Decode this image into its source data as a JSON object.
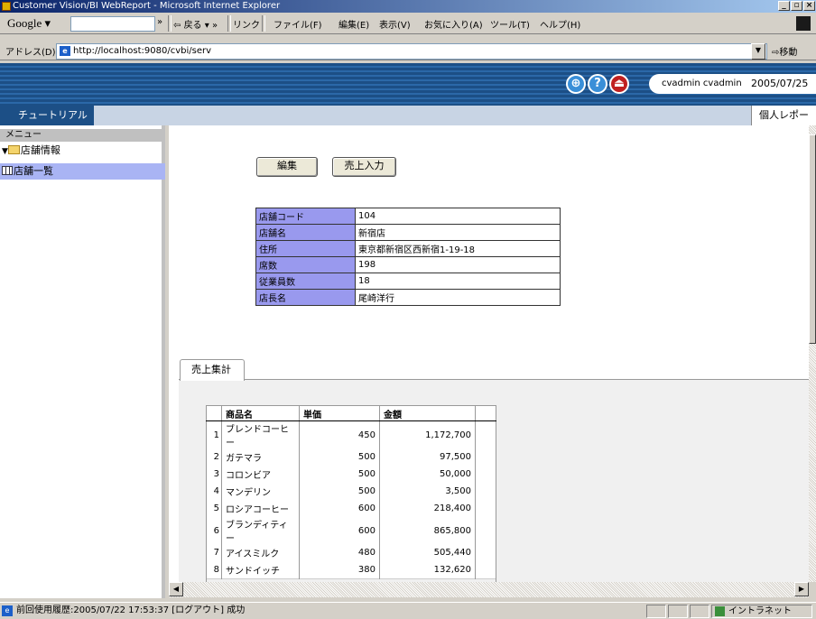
{
  "window": {
    "title": "Customer Vision/BI WebReport - Microsoft Internet Explorer"
  },
  "toolbar": {
    "google_label": "Google",
    "back_label": "戻る",
    "links_label": "リンク",
    "menu": [
      "ファイル(F)",
      "編集(E)",
      "表示(V)",
      "お気に入り(A)",
      "ツール(T)",
      "ヘルプ(H)"
    ]
  },
  "address": {
    "label": "アドレス(D)",
    "url": "http://localhost:9080/cvbi/serv",
    "go_label": "移動"
  },
  "header": {
    "user": "cvadmin cvadmin",
    "date": "2005/07/25"
  },
  "nav": {
    "tutorial": "チュートリアル",
    "personal_report": "個人レポート"
  },
  "sidebar": {
    "menu_header": "メニュー",
    "items": [
      {
        "label": "店舗情報"
      },
      {
        "label": "店舗一覧"
      }
    ]
  },
  "actions": {
    "edit": "編集",
    "sales_input": "売上入力"
  },
  "store_info": [
    {
      "label": "店舗コード",
      "value": "104"
    },
    {
      "label": "店舗名",
      "value": "新宿店"
    },
    {
      "label": "住所",
      "value": "東京都新宿区西新宿1-19-18"
    },
    {
      "label": "席数",
      "value": "198"
    },
    {
      "label": "従業員数",
      "value": "18"
    },
    {
      "label": "店長名",
      "value": "尾崎洋行"
    }
  ],
  "sales_tab": {
    "label": "売上集計"
  },
  "sales_table": {
    "headers": [
      "商品名",
      "単価",
      "金額"
    ],
    "rows": [
      {
        "idx": "1",
        "name": "ブレンドコーヒー",
        "price": "450",
        "amount": "1,172,700"
      },
      {
        "idx": "2",
        "name": "ガテマラ",
        "price": "500",
        "amount": "97,500"
      },
      {
        "idx": "3",
        "name": "コロンビア",
        "price": "500",
        "amount": "50,000"
      },
      {
        "idx": "4",
        "name": "マンデリン",
        "price": "500",
        "amount": "3,500"
      },
      {
        "idx": "5",
        "name": "ロシアコーヒー",
        "price": "600",
        "amount": "218,400"
      },
      {
        "idx": "6",
        "name": "ブランディティー",
        "price": "600",
        "amount": "865,800"
      },
      {
        "idx": "7",
        "name": "アイスミルク",
        "price": "480",
        "amount": "505,440"
      },
      {
        "idx": "8",
        "name": "サンドイッチ",
        "price": "380",
        "amount": "132,620"
      }
    ]
  },
  "status": {
    "text": "前回使用履歴:2005/07/22 17:53:37 [ログアウト] 成功",
    "zone": "イントラネット"
  },
  "colors": {
    "header_blue": "#1c4f86",
    "label_lavender": "#9999ee",
    "selected_item": "#a9b4f4"
  }
}
